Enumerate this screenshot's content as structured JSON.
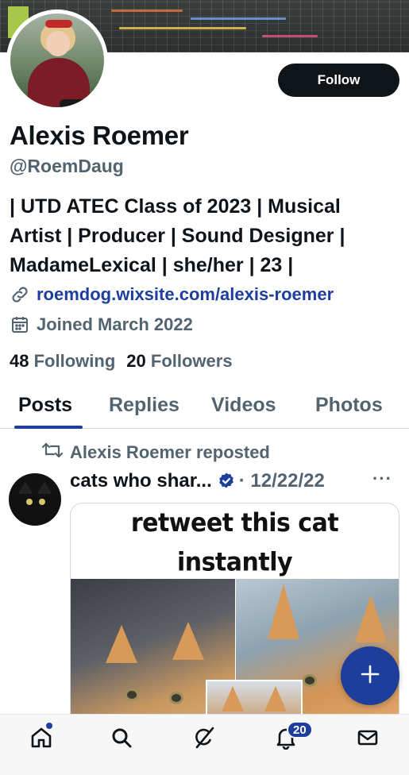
{
  "profile": {
    "display_name": "Alexis Roemer",
    "handle": "@RoemDaug",
    "bio_lines": [
      "| UTD ATEC Class of 2023 | Musical",
      "Artist | Producer | Sound Designer |",
      "MadameLexical | she/her | 23 |"
    ],
    "website": "roemdog.wixsite.com/alexis-roemer",
    "joined": "Joined March 2022",
    "following_count": "48",
    "following_label": "Following",
    "followers_count": "20",
    "followers_label": "Followers",
    "follow_button": "Follow"
  },
  "tabs": [
    {
      "label": "Posts",
      "active": true
    },
    {
      "label": "Replies",
      "active": false
    },
    {
      "label": "Videos",
      "active": false
    },
    {
      "label": "Photos",
      "active": false
    }
  ],
  "post": {
    "repost_text": "Alexis Roemer reposted",
    "author": "cats who shar...",
    "date": "· 12/22/22",
    "more": "···",
    "meme_caption_line1": "retweet this cat",
    "meme_caption_line2": "instantly"
  },
  "bottom_nav": {
    "items": [
      "home-icon",
      "search-icon",
      "grok-icon",
      "bell-icon",
      "mail-icon"
    ],
    "notification_badge": "20"
  },
  "colors": {
    "accent": "#1d3f9b",
    "text": "#0f1419",
    "muted": "#536471",
    "follow_bg": "#0f1419"
  }
}
